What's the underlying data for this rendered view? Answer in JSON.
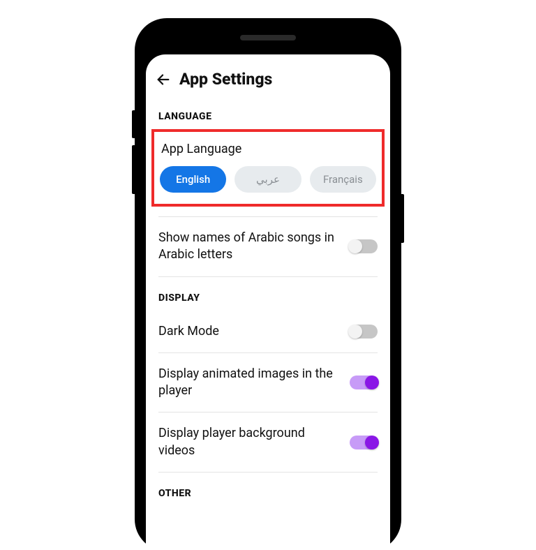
{
  "header": {
    "title": "App Settings"
  },
  "sections": {
    "language": {
      "header": "LANGUAGE",
      "appLanguageLabel": "App Language",
      "options": {
        "english": "English",
        "arabic": "عربي",
        "francais": "Français"
      },
      "arabicNames": "Show names of Arabic songs in Arabic letters"
    },
    "display": {
      "header": "DISPLAY",
      "darkMode": "Dark Mode",
      "animatedImages": "Display animated images in the player",
      "backgroundVideos": "Display player background videos"
    },
    "other": {
      "header": "OTHER"
    }
  },
  "toggles": {
    "arabicNames": false,
    "darkMode": false,
    "animatedImages": true,
    "backgroundVideos": true
  },
  "colors": {
    "accent": "#1476e6",
    "highlight": "#ef2b2b",
    "toggleOn": "#8a17e6"
  }
}
